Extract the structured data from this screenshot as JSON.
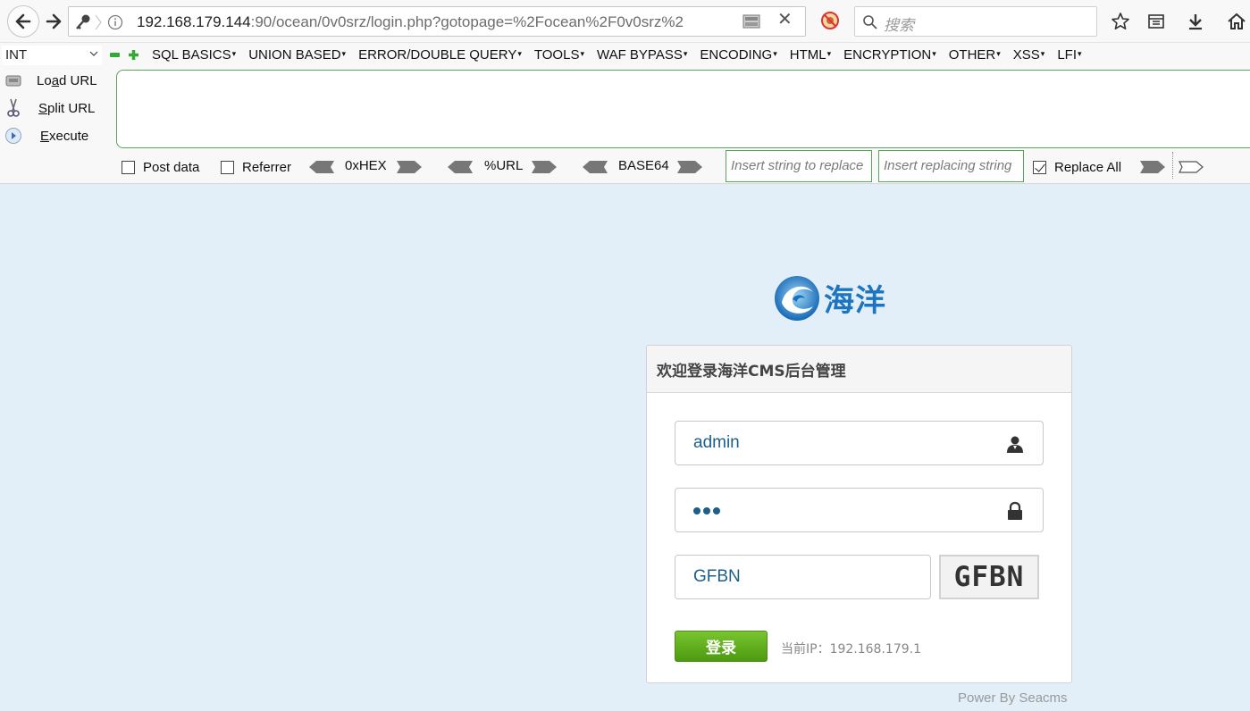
{
  "browser": {
    "url_host": "192.168.179.144",
    "url_rest": ":90/ocean/0v0srz/login.php?gotopage=%2Focean%2F0v0srz%2",
    "search_placeholder": "搜索"
  },
  "hackbar": {
    "select_value": "INT",
    "menu": [
      "SQL BASICS",
      "UNION BASED",
      "ERROR/DOUBLE QUERY",
      "TOOLS",
      "WAF BYPASS",
      "ENCODING",
      "HTML",
      "ENCRYPTION",
      "OTHER",
      "XSS",
      "LFI"
    ],
    "load_url_pre": "Lo",
    "load_url_u": "a",
    "load_url_post": "d URL",
    "split_url_u": "S",
    "split_url_post": "plit URL",
    "execute_u": "E",
    "execute_post": "xecute",
    "post_data": "Post data",
    "referrer": "Referrer",
    "hex": "0xHEX",
    "url": "%URL",
    "base64": "BASE64",
    "insert_string": "Insert string to replace",
    "insert_replacing": "Insert replacing string",
    "replace_all": "Replace All"
  },
  "login": {
    "logo_text": "海洋",
    "panel_title": "欢迎登录海洋CMS后台管理",
    "username": "admin",
    "password_dots": 3,
    "captcha_input": "GFBN",
    "captcha_image_text": "GFBN",
    "submit": "登录",
    "ip_label": "当前IP：192.168.179.1",
    "footer": "Power By Seacms"
  },
  "colors": {
    "page_bg": "#e2eff8",
    "accent_green": "#5aa35a",
    "button_green": "#5fae1d",
    "brand_blue": "#1d75c2"
  }
}
